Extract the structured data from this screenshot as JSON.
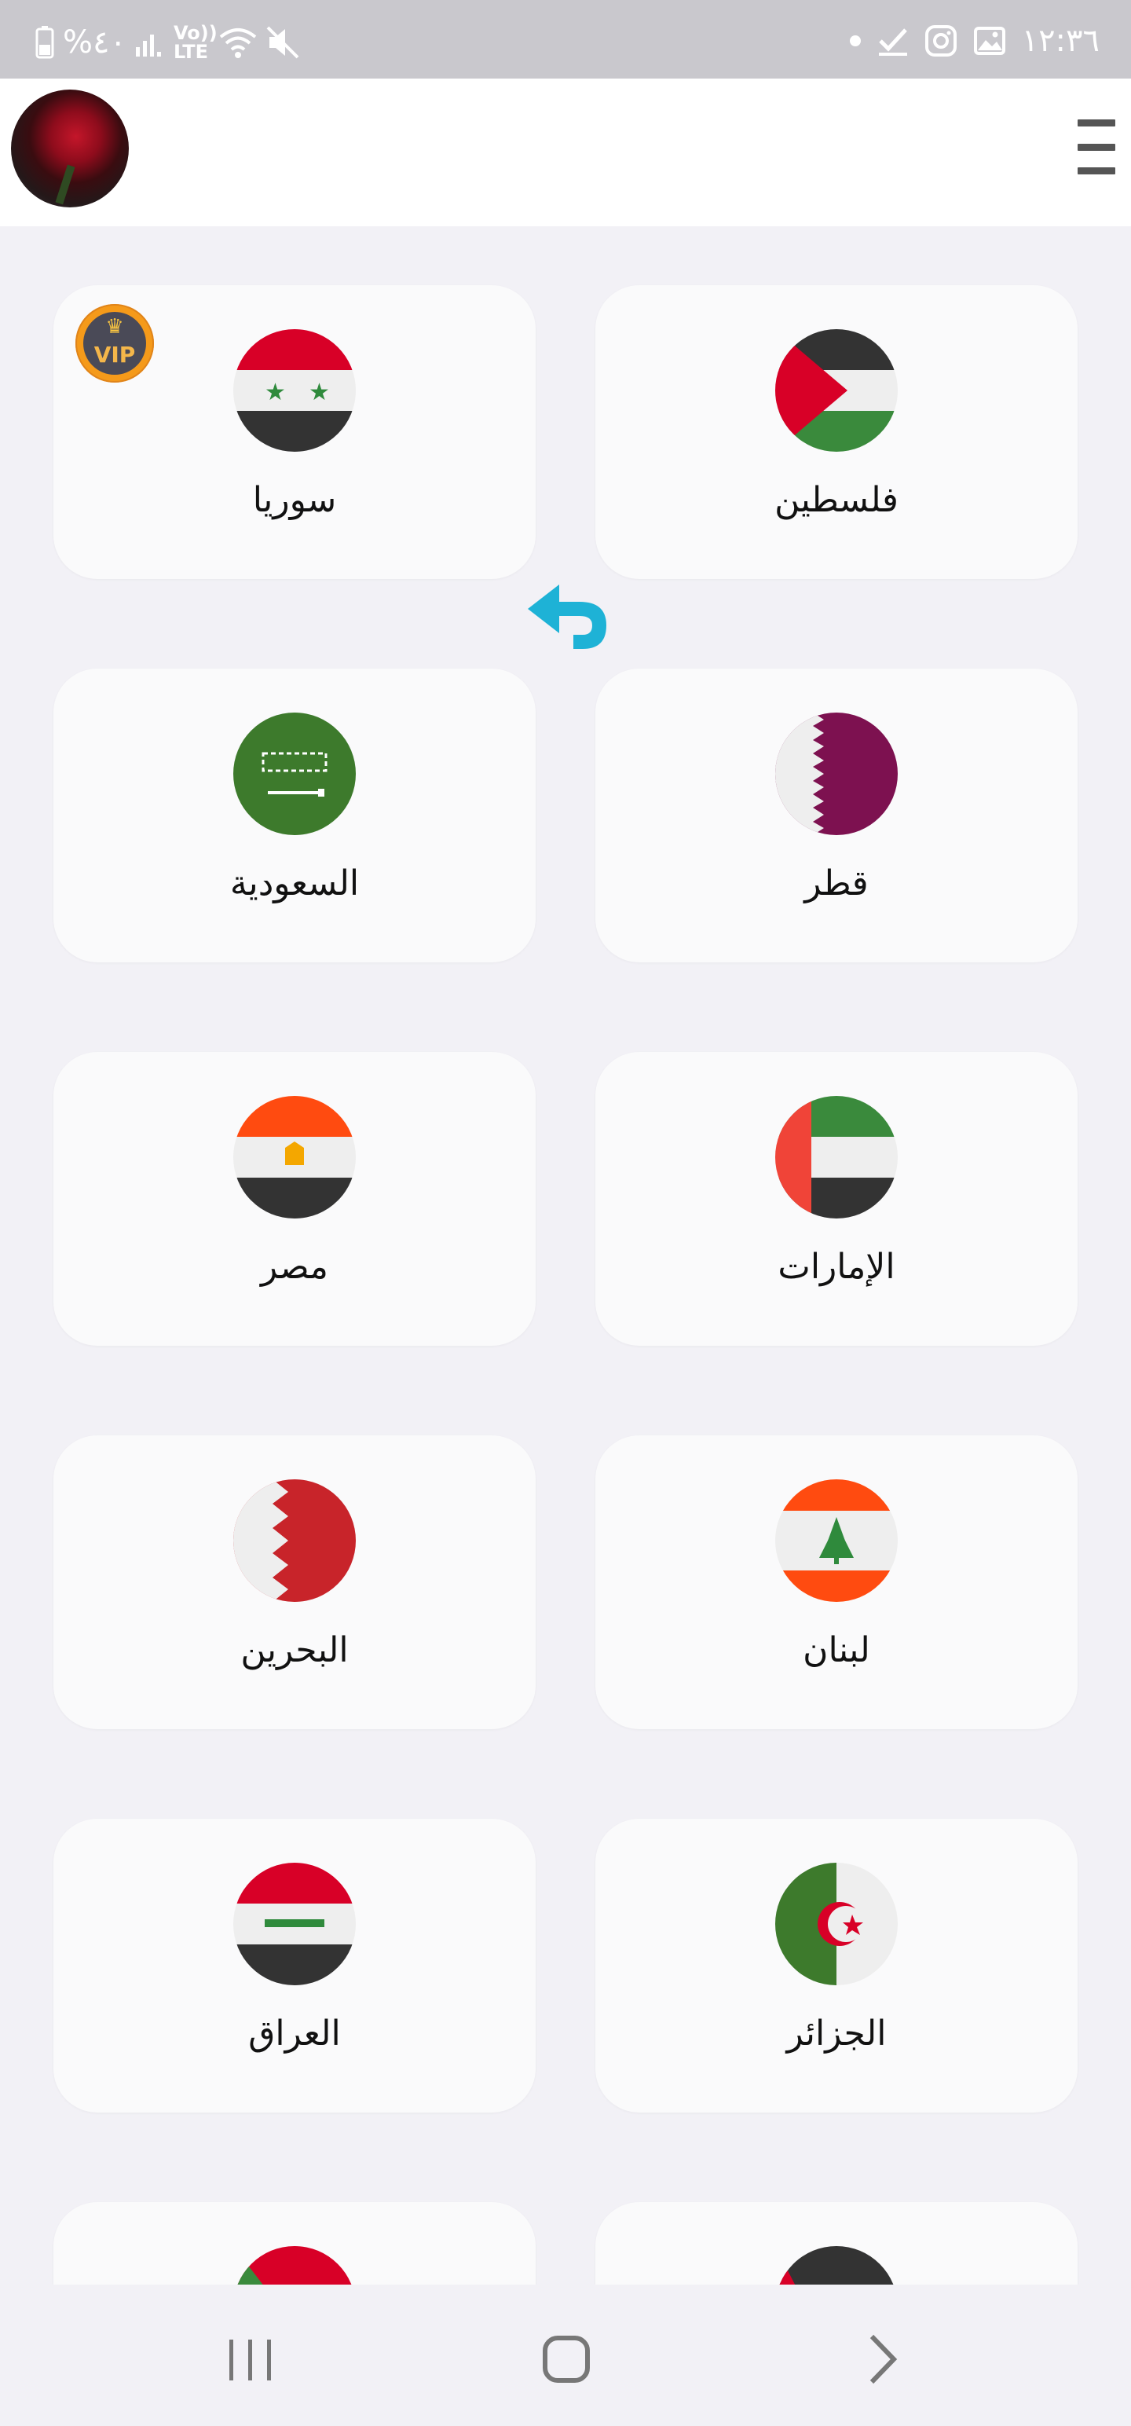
{
  "status_bar": {
    "time": "١٢:٣٦",
    "battery": "%٤٠",
    "volte": "Vo)) LTE",
    "icons": [
      "dot-icon",
      "check-icon",
      "instagram-icon",
      "gallery-icon",
      "battery-icon",
      "signal-icon",
      "wifi-icon",
      "mute-icon"
    ]
  },
  "app_bar": {
    "avatar": "avatar",
    "menu": "hamburger-menu-icon"
  },
  "vip_badge": {
    "label": "VIP"
  },
  "countries": [
    {
      "name": "سوريا",
      "flag": "syria"
    },
    {
      "name": "فلسطين",
      "flag": "palestine"
    },
    {
      "name": "السعودية",
      "flag": "saudi"
    },
    {
      "name": "قطر",
      "flag": "qatar"
    },
    {
      "name": "مصر",
      "flag": "egypt"
    },
    {
      "name": "الإمارات",
      "flag": "uae"
    },
    {
      "name": "البحرين",
      "flag": "bahrain"
    },
    {
      "name": "لبنان",
      "flag": "lebanon"
    },
    {
      "name": "العراق",
      "flag": "iraq"
    },
    {
      "name": "الجزائر",
      "flag": "algeria"
    }
  ],
  "colors": {
    "background": "#f2f1f6",
    "card": "#fafafb",
    "accent_arrow": "#1eb2d6",
    "status_bar": "#c9c8cd"
  },
  "nav_bar": {
    "buttons": [
      "recent-apps-icon",
      "home-icon",
      "back-icon"
    ]
  }
}
